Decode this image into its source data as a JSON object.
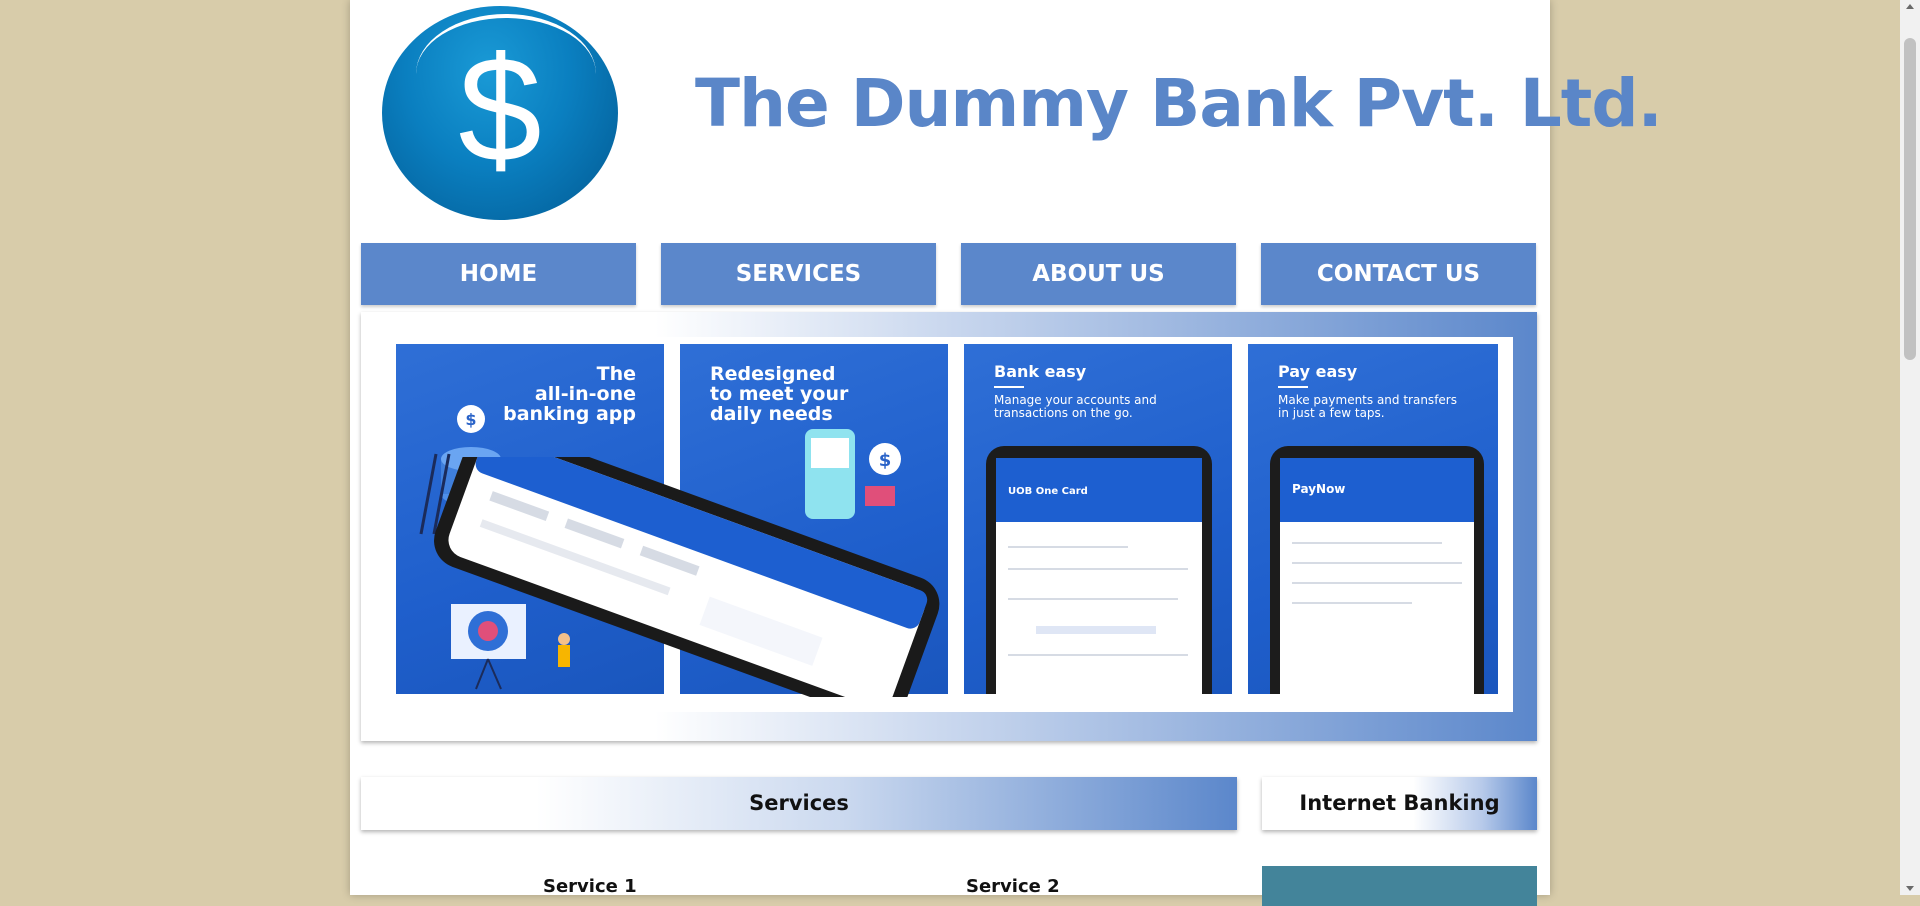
{
  "header": {
    "logo_symbol": "$",
    "title": "The Dummy Bank Pvt. Ltd."
  },
  "nav": {
    "items": [
      {
        "label": "HOME"
      },
      {
        "label": "SERVICES"
      },
      {
        "label": "ABOUT US"
      },
      {
        "label": "CONTACT US"
      }
    ]
  },
  "banner": {
    "panels": [
      {
        "title_lines": [
          "The",
          "all-in-one",
          "banking app"
        ]
      },
      {
        "title_lines": [
          "Redesigned",
          "to meet your",
          "daily needs"
        ]
      },
      {
        "title": "Bank easy",
        "subtitle_lines": [
          "Manage your accounts and",
          "transactions on the go."
        ],
        "screen_title": "UOB One Card"
      },
      {
        "title": "Pay easy",
        "subtitle_lines": [
          "Make payments and transfers",
          "in just a few taps."
        ],
        "screen_title": "PayNow"
      }
    ]
  },
  "sections": {
    "services_title": "Services",
    "internet_banking_title": "Internet Banking",
    "service_items": [
      {
        "label": "Service 1"
      },
      {
        "label": "Service 2"
      }
    ]
  },
  "colors": {
    "page_bg": "#d8ccaa",
    "brand_blue": "#5b87cb",
    "title_blue": "#5a86c8",
    "app_blue": "#1f5fcc",
    "ib_box": "#43849a"
  }
}
